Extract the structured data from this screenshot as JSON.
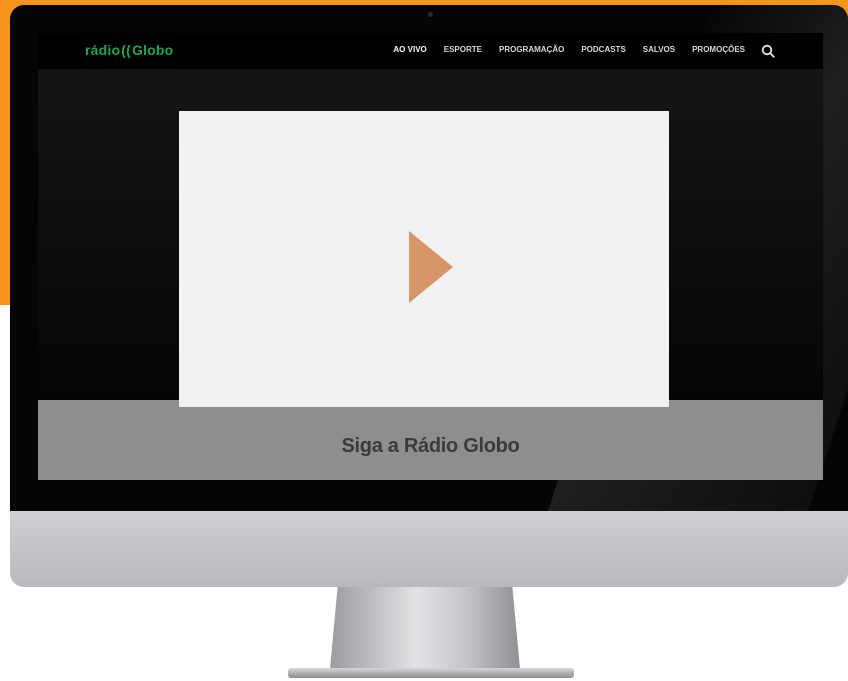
{
  "navbar": {
    "logo_left": "rádio",
    "logo_waves": "((",
    "logo_right": "Globo",
    "items": [
      {
        "label": "AO VIVO"
      },
      {
        "label": "ESPORTE"
      },
      {
        "label": "PROGRAMAÇÃO"
      },
      {
        "label": "PODCASTS"
      },
      {
        "label": "SALVOS"
      },
      {
        "label": "PROMOÇÕES"
      }
    ],
    "search_icon": "search-icon"
  },
  "video": {
    "play_icon": "play-icon"
  },
  "follow": {
    "title": "Siga a Rádio Globo"
  },
  "colors": {
    "brand_green": "#1ea54a",
    "accent_orange": "#f7941d",
    "play_orange": "#d9956a",
    "band_gray": "#8e8e8e"
  }
}
